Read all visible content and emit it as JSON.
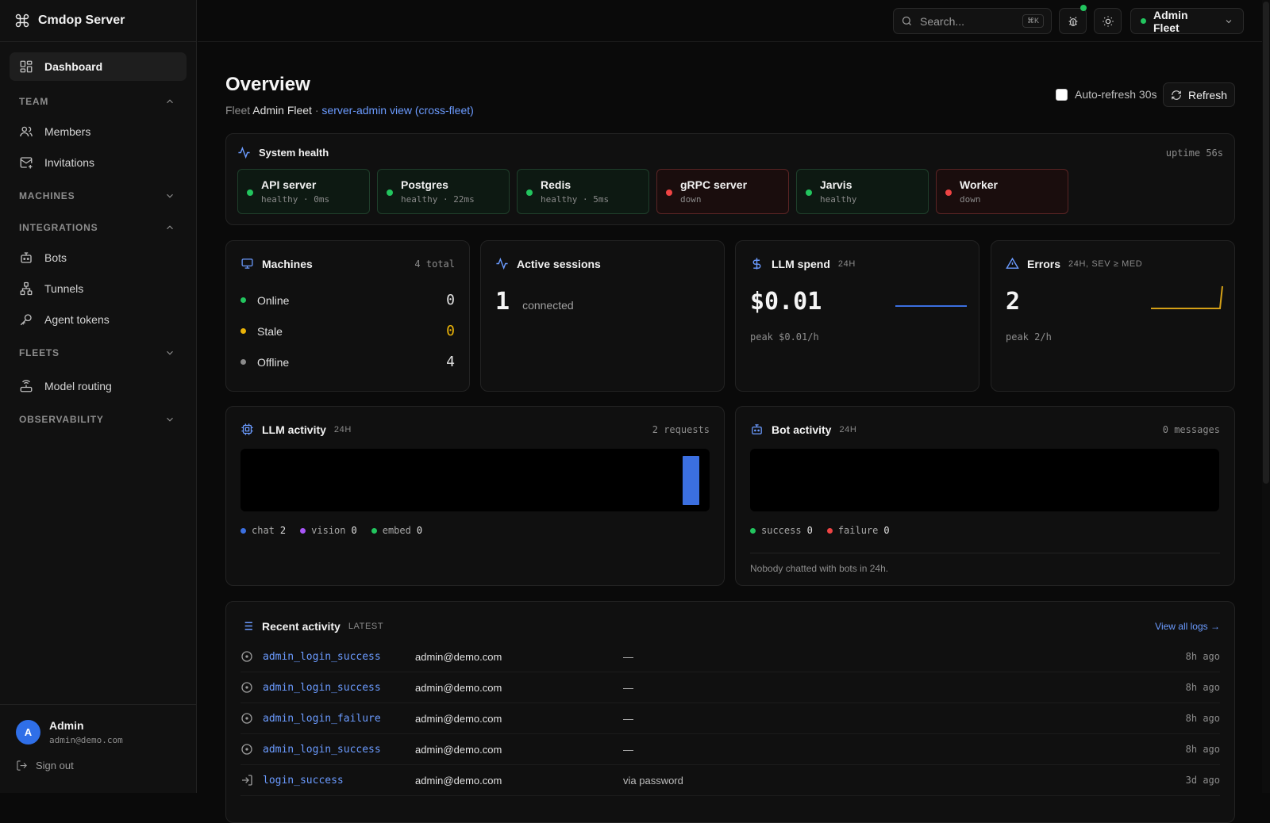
{
  "app": {
    "title": "Cmdop Server"
  },
  "sidebar": {
    "dashboard": "Dashboard",
    "sections": {
      "team": "TEAM",
      "machines": "MACHINES",
      "integrations": "INTEGRATIONS",
      "fleets": "FLEETS",
      "observability": "OBSERVABILITY"
    },
    "team_items": [
      "Members",
      "Invitations"
    ],
    "integration_items": [
      "Bots",
      "Tunnels",
      "Agent tokens"
    ],
    "fleet_items": [
      "Model routing"
    ],
    "user": {
      "initial": "A",
      "name": "Admin",
      "email": "admin@demo.com",
      "sign_out": "Sign out"
    }
  },
  "topbar": {
    "search_placeholder": "Search...",
    "search_shortcut": "⌘K",
    "fleet": "Admin Fleet",
    "fleet_status_color": "#22c55e"
  },
  "page": {
    "title": "Overview",
    "subtitle_prefix": "Fleet",
    "fleet_name": "Admin Fleet",
    "separator": "·",
    "view_link": "server-admin view (cross-fleet)",
    "auto_refresh": "Auto-refresh 30s",
    "refresh": "Refresh"
  },
  "health": {
    "title": "System health",
    "uptime": "uptime 56s",
    "services": [
      {
        "name": "API server",
        "status": "healthy · 0ms",
        "state": "ok"
      },
      {
        "name": "Postgres",
        "status": "healthy · 22ms",
        "state": "ok"
      },
      {
        "name": "Redis",
        "status": "healthy · 5ms",
        "state": "ok"
      },
      {
        "name": "gRPC server",
        "status": "down",
        "state": "down"
      },
      {
        "name": "Jarvis",
        "status": "healthy",
        "state": "ok"
      },
      {
        "name": "Worker",
        "status": "down",
        "state": "down"
      }
    ]
  },
  "machines": {
    "title": "Machines",
    "total": "4 total",
    "online_label": "Online",
    "online_count": "0",
    "stale_label": "Stale",
    "stale_count": "0",
    "offline_label": "Offline",
    "offline_count": "4"
  },
  "sessions": {
    "title": "Active sessions",
    "count": "1",
    "label": "connected"
  },
  "spend": {
    "title": "LLM spend",
    "tag": "24H",
    "value": "$0.01",
    "peak": "peak $0.01/h",
    "spark_color": "#3b6fe0"
  },
  "errors": {
    "title": "Errors",
    "tag": "24H, SEV ≥ MED",
    "value": "2",
    "peak": "peak 2/h",
    "spark_color": "#d4a017"
  },
  "llm_activity": {
    "title": "LLM activity",
    "tag": "24H",
    "requests": "2 requests",
    "legend": [
      {
        "label": "chat",
        "value": "2",
        "color": "#3b6fe0"
      },
      {
        "label": "vision",
        "value": "0",
        "color": "#a855f7"
      },
      {
        "label": "embed",
        "value": "0",
        "color": "#22c55e"
      }
    ],
    "bar_color": "#3b6fe0"
  },
  "bot_activity": {
    "title": "Bot activity",
    "tag": "24H",
    "messages": "0 messages",
    "legend": [
      {
        "label": "success",
        "value": "0",
        "color": "#22c55e"
      },
      {
        "label": "failure",
        "value": "0",
        "color": "#ef4444"
      }
    ],
    "empty_note": "Nobody chatted with bots in 24h."
  },
  "recent": {
    "title": "Recent activity",
    "tag": "LATEST",
    "view_all": "View all logs →",
    "rows": [
      {
        "icon": "circle-dot-icon",
        "event": "admin_login_success",
        "actor": "admin@demo.com",
        "detail": "—",
        "time": "8h ago"
      },
      {
        "icon": "circle-dot-icon",
        "event": "admin_login_success",
        "actor": "admin@demo.com",
        "detail": "—",
        "time": "8h ago"
      },
      {
        "icon": "circle-dot-icon",
        "event": "admin_login_failure",
        "actor": "admin@demo.com",
        "detail": "—",
        "time": "8h ago"
      },
      {
        "icon": "circle-dot-icon",
        "event": "admin_login_success",
        "actor": "admin@demo.com",
        "detail": "—",
        "time": "8h ago"
      },
      {
        "icon": "login-arrow-icon",
        "event": "login_success",
        "actor": "admin@demo.com",
        "detail": "via password",
        "time": "3d ago"
      }
    ]
  },
  "colors": {
    "accent": "#6b9bff",
    "ok": "#22c55e",
    "stale": "#eab308",
    "down": "#ef4444",
    "offline": "#8a8a8a"
  }
}
